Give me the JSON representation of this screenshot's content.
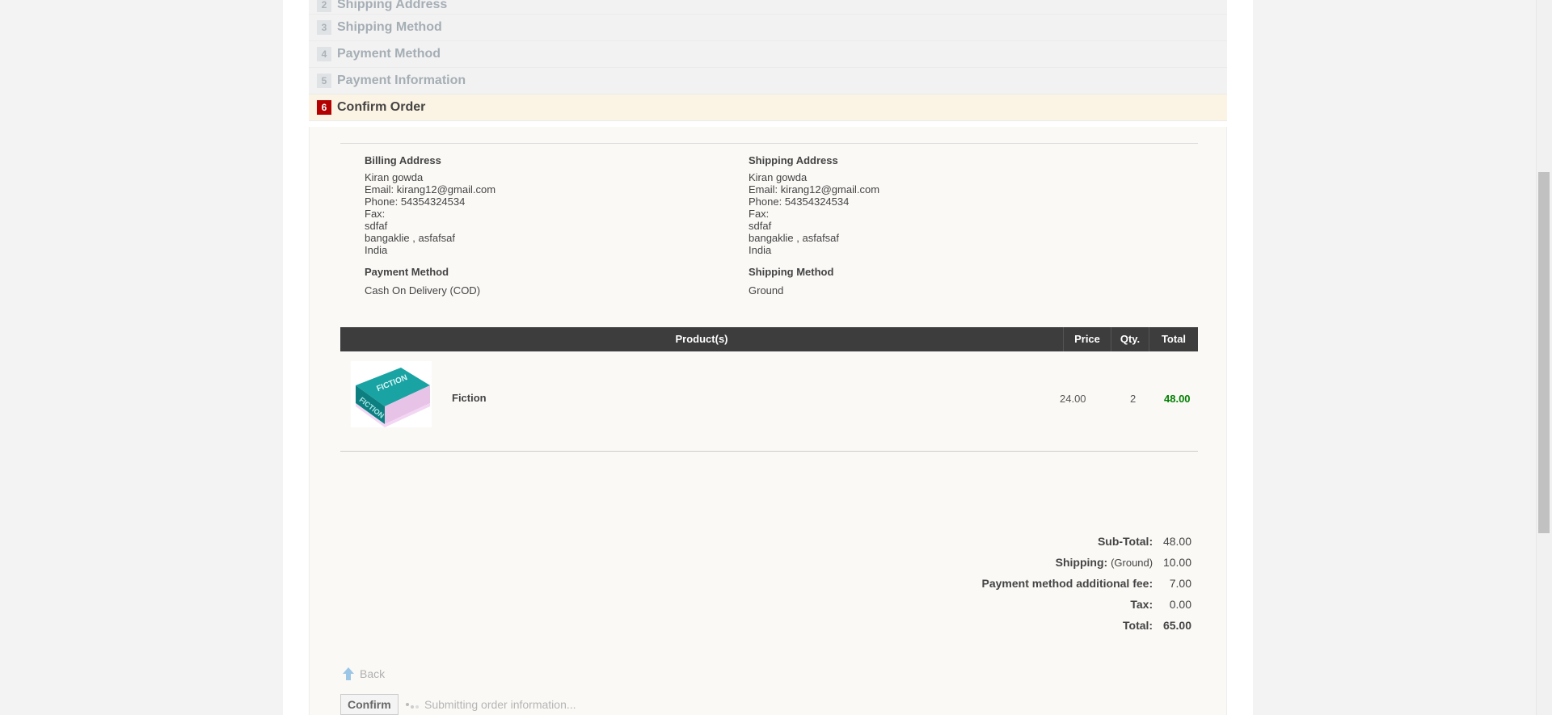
{
  "steps": [
    {
      "num": "2",
      "label": "Shipping Address"
    },
    {
      "num": "3",
      "label": "Shipping Method"
    },
    {
      "num": "4",
      "label": "Payment Method"
    },
    {
      "num": "5",
      "label": "Payment Information"
    },
    {
      "num": "6",
      "label": "Confirm Order"
    }
  ],
  "billing": {
    "title": "Billing Address",
    "name": "Kiran gowda",
    "email": "Email: kirang12@gmail.com",
    "phone": "Phone: 54354324534",
    "fax": "Fax:",
    "address1": "sdfaf",
    "city": "bangaklie , asfafsaf",
    "country": "India"
  },
  "shipping": {
    "title": "Shipping Address",
    "name": "Kiran gowda",
    "email": "Email: kirang12@gmail.com",
    "phone": "Phone: 54354324534",
    "fax": "Fax:",
    "address1": "sdfaf",
    "city": "bangaklie , asfafsaf",
    "country": "India"
  },
  "payment_method": {
    "title": "Payment Method",
    "value": "Cash On Delivery (COD)"
  },
  "shipping_method": {
    "title": "Shipping Method",
    "value": "Ground"
  },
  "cart": {
    "headers": {
      "product": "Product(s)",
      "price": "Price",
      "qty": "Qty.",
      "total": "Total"
    },
    "items": [
      {
        "name": "Fiction",
        "price": "24.00",
        "qty": "2",
        "total": "48.00",
        "image_text": "FICTION"
      }
    ]
  },
  "totals": {
    "subtotal_label": "Sub-Total:",
    "subtotal": "48.00",
    "shipping_label": "Shipping:",
    "shipping_method": "(Ground)",
    "shipping": "10.00",
    "fee_label": "Payment method additional fee:",
    "fee": "7.00",
    "tax_label": "Tax:",
    "tax": "0.00",
    "total_label": "Total:",
    "total": "65.00"
  },
  "actions": {
    "back_label": "Back",
    "confirm_label": "Confirm",
    "submitting_text": "Submitting order information..."
  },
  "colors": {
    "accent": "#b30000",
    "total_green": "#008000",
    "header_bg": "#3d3d3d"
  }
}
